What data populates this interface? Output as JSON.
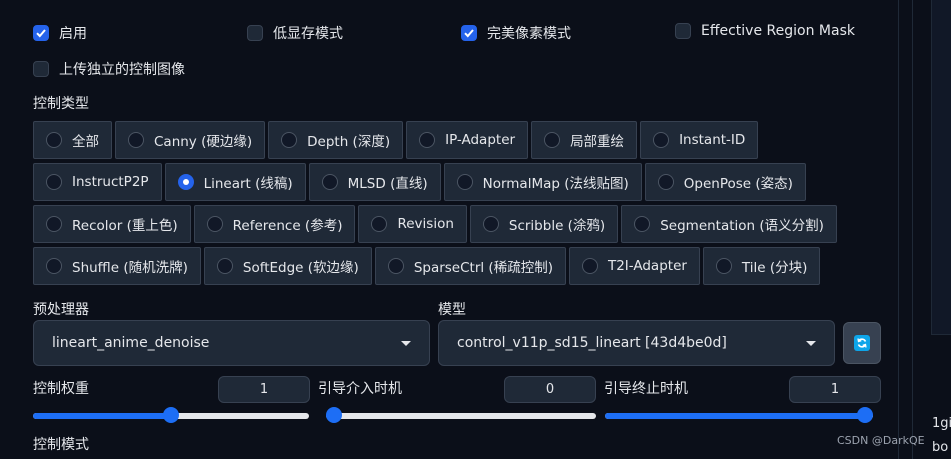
{
  "checkboxes": {
    "enable": {
      "label": "启用",
      "checked": true
    },
    "low_vram": {
      "label": "低显存模式",
      "checked": false
    },
    "pixel_perfect": {
      "label": "完美像素模式",
      "checked": true
    },
    "effective_region_mask": {
      "label": "Effective Region Mask",
      "checked": false
    },
    "upload_independent": {
      "label": "上传独立的控制图像",
      "checked": false
    }
  },
  "control_type": {
    "title": "控制类型",
    "selected": "Lineart (线稿)",
    "rows": [
      [
        "全部",
        "Canny (硬边缘)",
        "Depth (深度)",
        "IP-Adapter",
        "局部重绘",
        "Instant-ID"
      ],
      [
        "InstructP2P",
        "Lineart (线稿)",
        "MLSD (直线)",
        "NormalMap (法线贴图)",
        "OpenPose (姿态)"
      ],
      [
        "Recolor (重上色)",
        "Reference (参考)",
        "Revision",
        "Scribble (涂鸦)",
        "Segmentation (语义分割)"
      ],
      [
        "Shuffle (随机洗牌)",
        "SoftEdge (软边缘)",
        "SparseCtrl (稀疏控制)",
        "T2I-Adapter",
        "Tile (分块)"
      ]
    ]
  },
  "preprocessor": {
    "label": "预处理器",
    "value": "lineart_anime_denoise"
  },
  "model": {
    "label": "模型",
    "value": "control_v11p_sd15_lineart [43d4be0d]"
  },
  "refresh_icon": "refresh-icon",
  "sliders": {
    "weight": {
      "label": "控制权重",
      "value": "1",
      "fraction": 0.5
    },
    "start": {
      "label": "引导介入时机",
      "value": "0",
      "fraction": 0.0
    },
    "end": {
      "label": "引导终止时机",
      "value": "1",
      "fraction": 1.0
    }
  },
  "control_mode": {
    "label": "控制模式"
  },
  "gutter": {
    "line1": "1gi",
    "line2": "bo"
  },
  "watermark": "CSDN @DarkQE",
  "colors": {
    "accent": "#2563eb",
    "background": "#0b0f19",
    "panel": "#1f2937"
  }
}
